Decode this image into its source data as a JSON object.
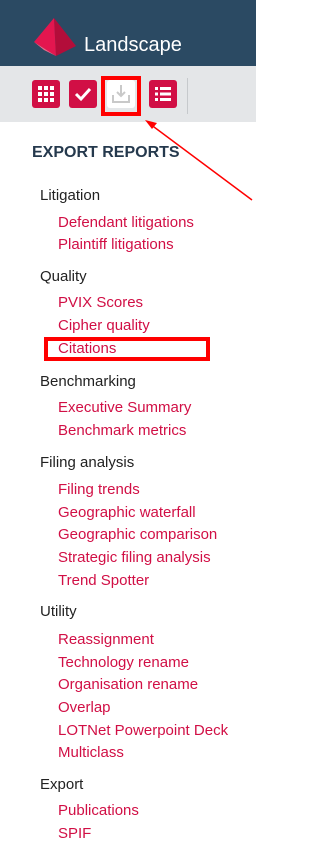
{
  "app": {
    "title": "Landscape"
  },
  "toolbar": {
    "buttons": [
      {
        "name": "grid-view",
        "icon": "grid-icon"
      },
      {
        "name": "checked",
        "icon": "check-icon"
      },
      {
        "name": "export",
        "icon": "download-tray-icon"
      },
      {
        "name": "list-view",
        "icon": "list-icon"
      }
    ]
  },
  "panel": {
    "title": "EXPORT REPORTS",
    "groups": [
      {
        "label": "Litigation",
        "items": [
          "Defendant litigations",
          "Plaintiff litigations"
        ]
      },
      {
        "label": "Quality",
        "items": [
          "PVIX Scores",
          "Cipher quality",
          "Citations"
        ]
      },
      {
        "label": "Benchmarking",
        "items": [
          "Executive Summary",
          "Benchmark metrics"
        ]
      },
      {
        "label": "Filing analysis",
        "items": [
          "Filing trends",
          "Geographic waterfall",
          "Geographic comparison",
          "Strategic filing analysis",
          "Trend Spotter"
        ]
      },
      {
        "label": "Utility",
        "items": [
          "Reassignment",
          "Technology rename",
          "Organisation rename",
          "Overlap",
          "LOTNet Powerpoint Deck",
          "Multiclass"
        ]
      },
      {
        "label": "Export",
        "items": [
          "Publications",
          "SPIF"
        ]
      }
    ]
  },
  "colors": {
    "header_bg": "#2b4a63",
    "accent": "#d10f45",
    "toolbar_bg": "#e4e6e8",
    "annotation": "#ff0000"
  }
}
